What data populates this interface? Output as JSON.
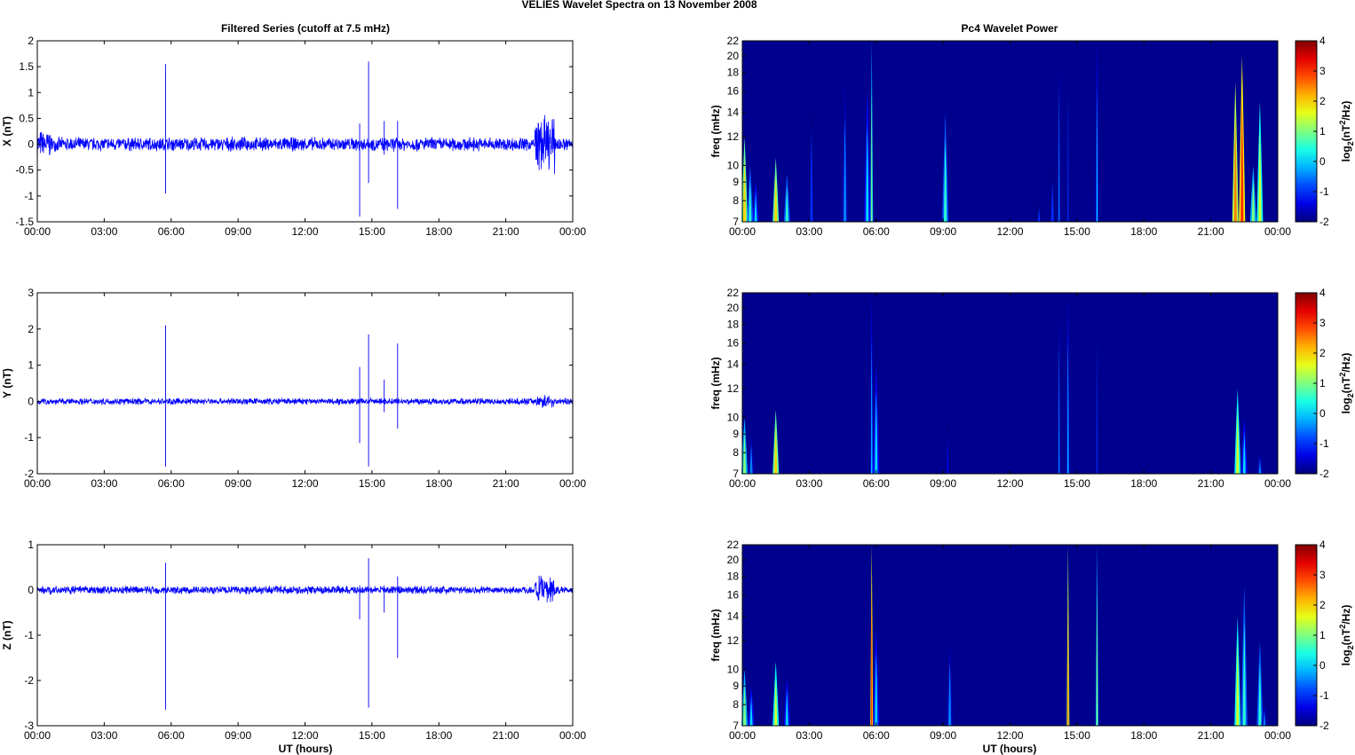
{
  "title": "VELIES Wavelet Spectra on 13 November  2008",
  "left_title": "Filtered Series (cutoff at 7.5 mHz)",
  "right_title": "Pc4 Wavelet Power",
  "xlabel": "UT (hours)",
  "xticks": [
    "00:00",
    "03:00",
    "06:00",
    "09:00",
    "12:00",
    "15:00",
    "18:00",
    "21:00",
    "00:00"
  ],
  "freq_label": "freq (mHz)",
  "colorbar_label": "log2(nT2/Hz)",
  "colorbar_ticks": [
    "4",
    "3",
    "2",
    "1",
    "0",
    "-1",
    "-2"
  ],
  "chart_data": [
    {
      "type": "line",
      "component": "X",
      "ylabel": "X (nT)",
      "ylim": [
        -1.5,
        2
      ],
      "yticks": [
        "2",
        "1.5",
        "1",
        "0.5",
        "0",
        "-0.5",
        "-1",
        "-1.5"
      ],
      "xlim_hours": [
        0,
        24
      ],
      "noise_amplitude": 0.15,
      "color": "#0000ff",
      "spikes": [
        [
          5.75,
          1.55,
          -0.95
        ],
        [
          14.45,
          0.4,
          -1.4
        ],
        [
          14.85,
          1.6,
          -0.75
        ],
        [
          15.55,
          0.45,
          -0.2
        ],
        [
          16.15,
          0.45,
          -1.25
        ]
      ],
      "bursts": [
        [
          22.3,
          23.2,
          0.6
        ],
        [
          0,
          0.6,
          0.3
        ]
      ]
    },
    {
      "type": "line",
      "component": "Y",
      "ylabel": "Y (nT)",
      "ylim": [
        -2,
        3
      ],
      "yticks": [
        "3",
        "2",
        "1",
        "0",
        "-1",
        "-2"
      ],
      "xlim_hours": [
        0,
        24
      ],
      "noise_amplitude": 0.1,
      "color": "#0000ff",
      "spikes": [
        [
          5.75,
          2.1,
          -1.8
        ],
        [
          14.45,
          0.95,
          -1.15
        ],
        [
          14.85,
          1.85,
          -1.8
        ],
        [
          15.55,
          0.6,
          -0.3
        ],
        [
          16.15,
          1.6,
          -0.75
        ]
      ],
      "bursts": [
        [
          22.3,
          23.2,
          0.2
        ]
      ]
    },
    {
      "type": "line",
      "component": "Z",
      "ylabel": "Z (nT)",
      "ylim": [
        -3,
        1
      ],
      "yticks": [
        "1",
        "0",
        "-1",
        "-2",
        "-3"
      ],
      "xlim_hours": [
        0,
        24
      ],
      "noise_amplitude": 0.1,
      "color": "#0000ff",
      "spikes": [
        [
          5.75,
          0.6,
          -2.65
        ],
        [
          14.45,
          0.1,
          -0.65
        ],
        [
          14.85,
          0.7,
          -2.6
        ],
        [
          15.55,
          0.1,
          -0.5
        ],
        [
          16.15,
          0.3,
          -1.5
        ]
      ],
      "bursts": [
        [
          22.3,
          23.2,
          0.35
        ]
      ]
    },
    {
      "type": "heatmap",
      "component": "X",
      "ylim_mHz": [
        7,
        22
      ],
      "yticks": [
        "22",
        "20",
        "18",
        "16",
        "14",
        "12",
        "10",
        "9",
        "8",
        "7"
      ],
      "clim": [
        -2,
        4
      ],
      "streaks": [
        [
          0.1,
          7,
          12,
          2
        ],
        [
          0.35,
          7,
          10,
          0.5
        ],
        [
          0.6,
          7,
          9,
          0
        ],
        [
          1.5,
          7,
          10.5,
          2
        ],
        [
          2,
          7,
          9.5,
          0.5
        ],
        [
          3.1,
          12,
          15.5,
          -1
        ],
        [
          4.6,
          10,
          17,
          -0.5
        ],
        [
          5.6,
          7,
          16,
          0
        ],
        [
          5.8,
          7,
          22,
          1
        ],
        [
          9.1,
          7,
          14,
          0.5
        ],
        [
          13.3,
          7,
          8,
          -1
        ],
        [
          13.9,
          7,
          10,
          -1
        ],
        [
          14.2,
          7,
          22,
          -0.5
        ],
        [
          14.6,
          7,
          22,
          -1
        ],
        [
          15.9,
          7,
          22,
          0
        ],
        [
          22.1,
          7,
          17,
          2.5
        ],
        [
          22.4,
          7,
          20,
          3
        ],
        [
          22.9,
          7,
          10,
          1
        ],
        [
          23.2,
          7,
          15,
          1.5
        ]
      ]
    },
    {
      "type": "heatmap",
      "component": "Y",
      "ylim_mHz": [
        7,
        22
      ],
      "yticks": [
        "22",
        "20",
        "18",
        "16",
        "14",
        "12",
        "10",
        "9",
        "8",
        "7"
      ],
      "clim": [
        -2,
        4
      ],
      "streaks": [
        [
          0.1,
          7,
          10,
          1
        ],
        [
          0.4,
          7,
          9,
          -0.5
        ],
        [
          1.5,
          7,
          10.5,
          2
        ],
        [
          5.8,
          7,
          22,
          0
        ],
        [
          6.0,
          7,
          14,
          0
        ],
        [
          9.2,
          7,
          10,
          -1.5
        ],
        [
          14.2,
          7,
          22,
          -0.5
        ],
        [
          14.6,
          7,
          22,
          0
        ],
        [
          15.9,
          7,
          22,
          -1
        ],
        [
          22.2,
          7,
          12,
          1.5
        ],
        [
          22.5,
          7,
          10,
          0
        ],
        [
          23.2,
          7,
          8,
          -0.5
        ]
      ]
    },
    {
      "type": "heatmap",
      "component": "Z",
      "ylim_mHz": [
        7,
        22
      ],
      "yticks": [
        "22",
        "20",
        "18",
        "16",
        "14",
        "12",
        "10",
        "9",
        "8",
        "7"
      ],
      "clim": [
        -2,
        4
      ],
      "streaks": [
        [
          0.1,
          7,
          10,
          1
        ],
        [
          0.4,
          7,
          9,
          0
        ],
        [
          1.5,
          7,
          10.5,
          1.5
        ],
        [
          2,
          7,
          9.5,
          0
        ],
        [
          5.8,
          7,
          22,
          3
        ],
        [
          6.0,
          7,
          13,
          0
        ],
        [
          9.3,
          9,
          12,
          -0.5
        ],
        [
          14.6,
          7,
          22,
          2.5
        ],
        [
          15.9,
          7,
          22,
          1
        ],
        [
          22.2,
          7,
          14,
          1.5
        ],
        [
          22.5,
          7,
          17,
          0.5
        ],
        [
          23.2,
          7,
          12,
          0.5
        ],
        [
          23.4,
          7,
          8,
          -0.5
        ]
      ]
    }
  ]
}
